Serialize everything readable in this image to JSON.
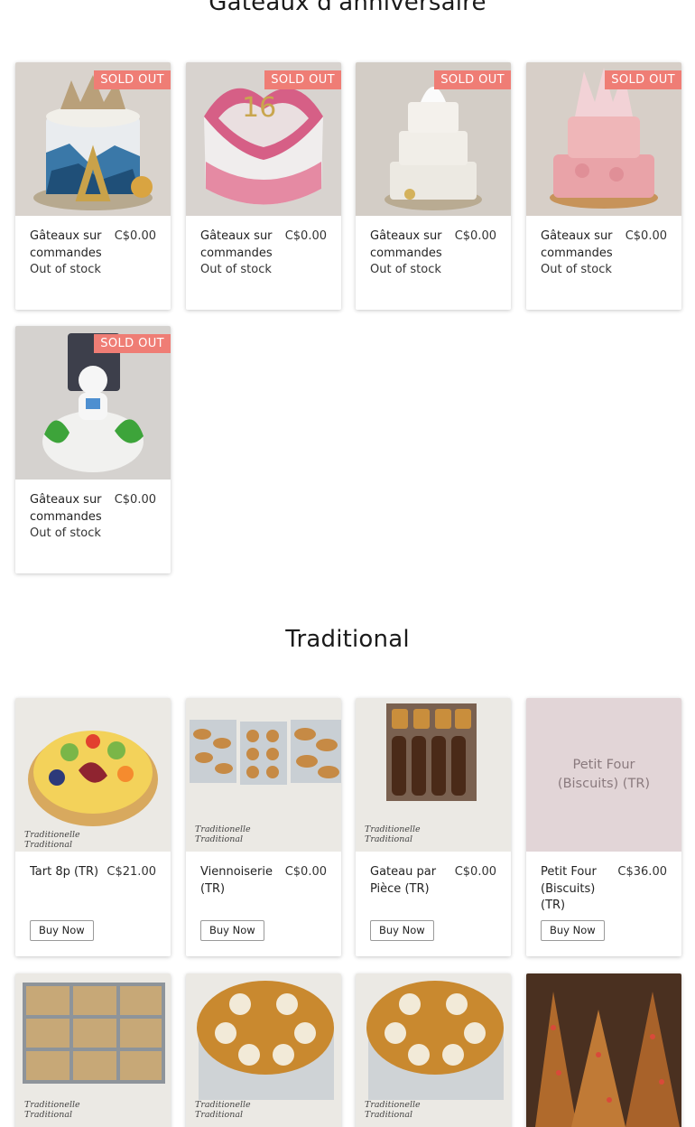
{
  "sections": [
    {
      "title": "Gâteaux d'anniversaire"
    },
    {
      "title": "Traditional"
    }
  ],
  "badge_label": "SOLD OUT",
  "out_of_stock_label": "Out of stock",
  "buy_label": "Buy Now",
  "watermark": {
    "line1": "Traditionelle",
    "line2": "Traditional"
  },
  "birthday_products": [
    {
      "name": "Gâteaux sur commandes",
      "price": "C$0.00"
    },
    {
      "name": "Gâteaux sur commandes",
      "price": "C$0.00"
    },
    {
      "name": "Gâteaux sur commandes",
      "price": "C$0.00"
    },
    {
      "name": "Gâteaux sur commandes",
      "price": "C$0.00"
    },
    {
      "name": "Gâteaux sur commandes",
      "price": "C$0.00"
    }
  ],
  "traditional_products": [
    {
      "name": "Tart 8p (TR)",
      "price": "C$21.00"
    },
    {
      "name": "Viennoiserie (TR)",
      "price": "C$0.00"
    },
    {
      "name": "Gateau par Pièce (TR)",
      "price": "C$0.00"
    },
    {
      "name": "Petit Four (Biscuits) (TR)",
      "price": "C$36.00",
      "placeholder": "Petit Four (Biscuits) (TR)"
    }
  ],
  "colors": {
    "badge": "#ef7d75",
    "placeholder_bg": "#e2d5d7"
  }
}
